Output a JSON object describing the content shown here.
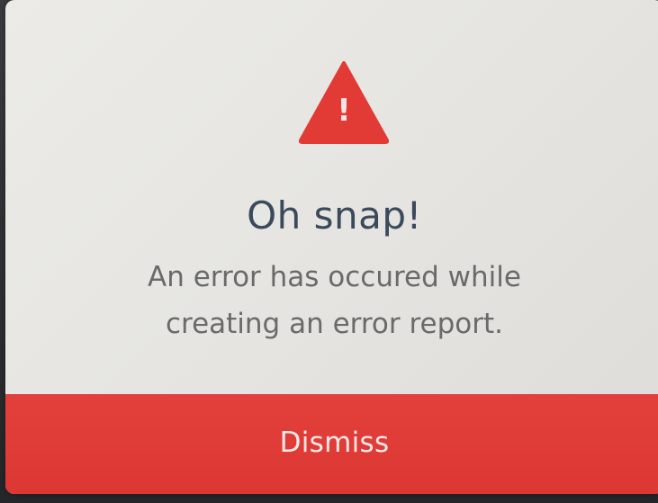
{
  "dialog": {
    "icon": "warning-triangle-icon",
    "icon_glyph": "!",
    "title": "Oh snap!",
    "message_line1": "An error has occured while",
    "message_line2": "creating an error report.",
    "dismiss_label": "Dismiss"
  },
  "colors": {
    "accent": "#e0403a",
    "dialog_background": "#e8e7e3",
    "title_text": "#3a4a5c",
    "message_text": "#6a6a6a"
  }
}
